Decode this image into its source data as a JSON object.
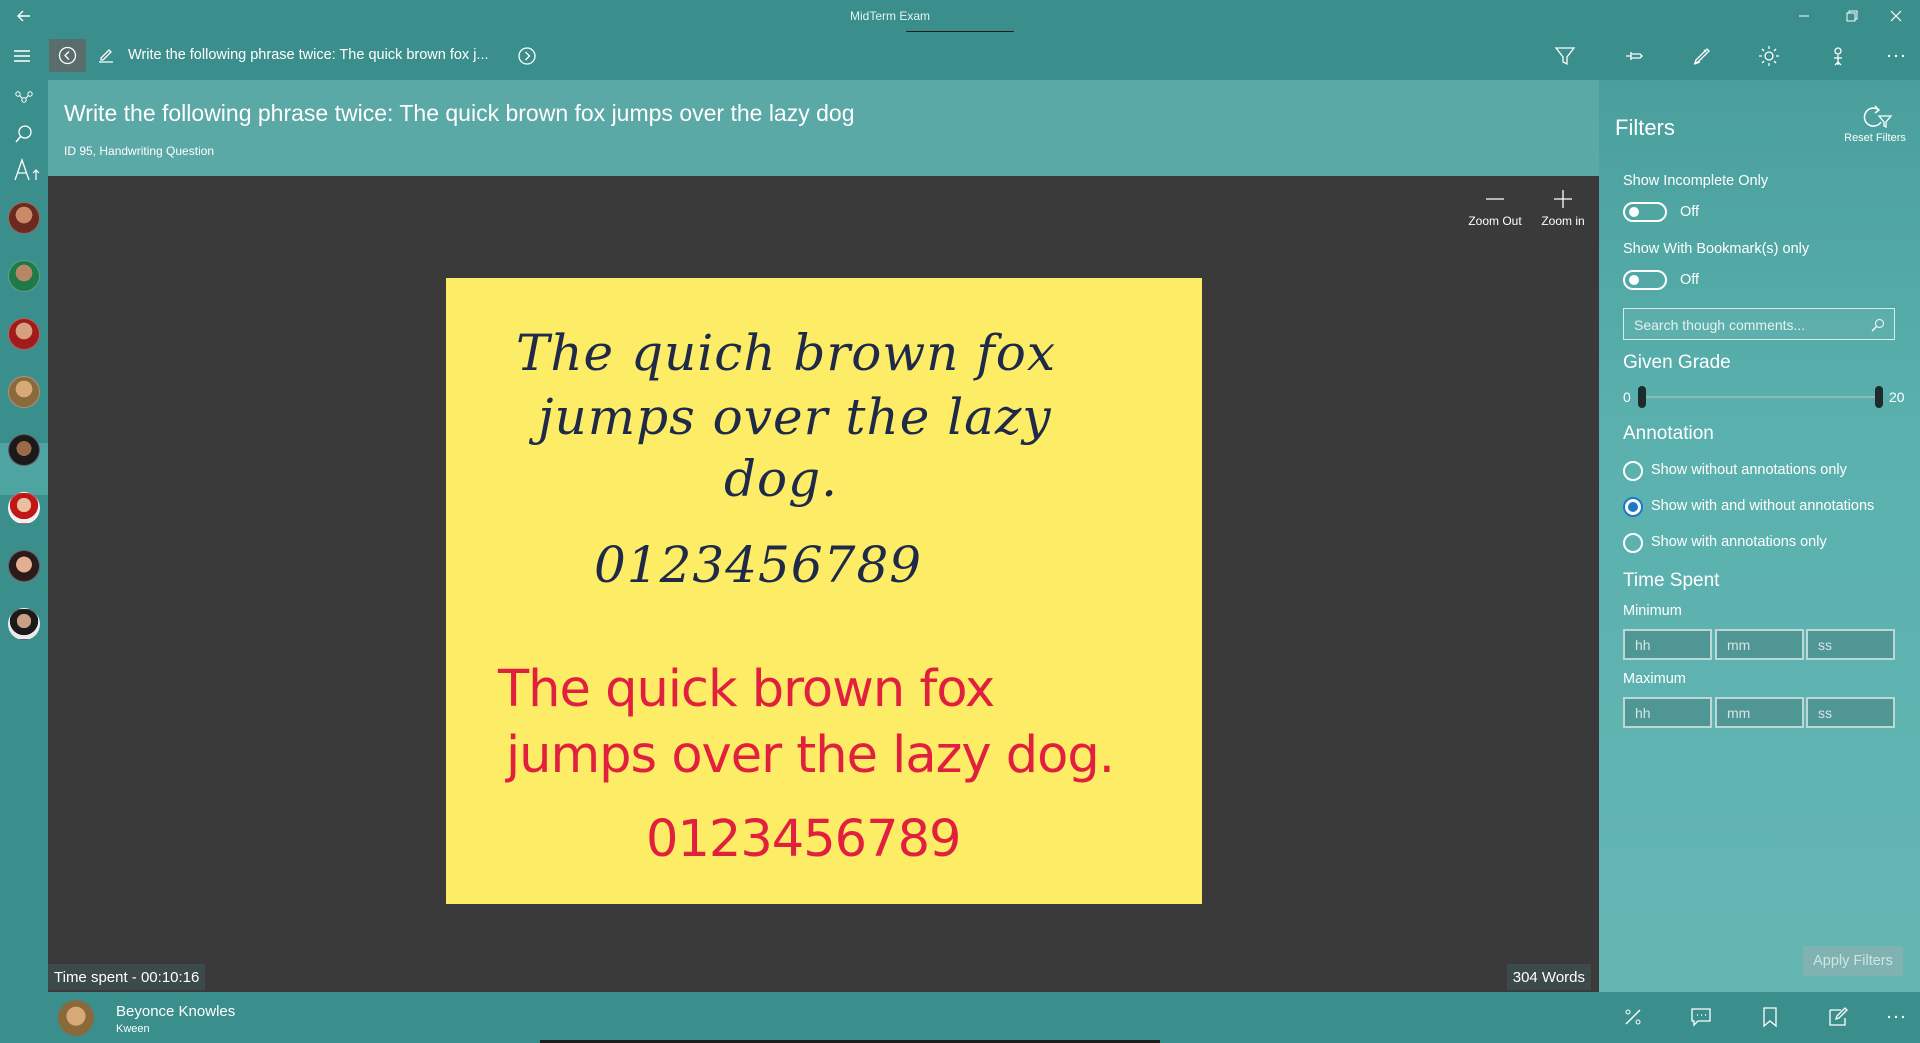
{
  "window": {
    "title": "MidTerm Exam"
  },
  "toolbar": {
    "question_title": "Write the following phrase twice: The quick brown fox j...",
    "icons": [
      "filter-icon",
      "pin-icon",
      "pen-icon",
      "brightness-icon",
      "user-rank-icon",
      "more-icon"
    ]
  },
  "rail": {
    "icons": [
      "group-icon",
      "search-icon",
      "sort-font-icon"
    ],
    "selected_index": 3
  },
  "question": {
    "title": "Write the following phrase twice: The quick brown fox jumps over the lazy dog",
    "meta": "ID 95, Handwriting Question"
  },
  "viewer": {
    "zoom_out_label": "Zoom Out",
    "zoom_in_label": "Zoom in",
    "note": {
      "blue_lines": [
        "The quich brown fox",
        "jumps over the lazy",
        "dog.",
        "0123456789"
      ],
      "red_lines": [
        "The quick brown fox",
        "jumps over the lazy dog.",
        "0123456789"
      ]
    },
    "time_spent": "Time spent - 00:10:16",
    "word_count": "304 Words"
  },
  "filters": {
    "title": "Filters",
    "reset_label": "Reset Filters",
    "incomplete_label": "Show Incomplete Only",
    "incomplete_state": "Off",
    "bookmark_label": "Show With Bookmark(s) only",
    "bookmark_state": "Off",
    "search_placeholder": "Search though comments...",
    "grade_heading": "Given Grade",
    "grade_min": "0",
    "grade_max": "20",
    "annotation_heading": "Annotation",
    "annotation_options": [
      {
        "label": "Show without annotations only",
        "selected": false
      },
      {
        "label": "Show with and without annotations",
        "selected": true
      },
      {
        "label": "Show with annotations only",
        "selected": false
      }
    ],
    "time_heading": "Time Spent",
    "minimum_label": "Minimum",
    "maximum_label": "Maximum",
    "time_placeholders": {
      "hh": "hh",
      "mm": "mm",
      "ss": "ss"
    },
    "apply_label": "Apply Filters"
  },
  "student": {
    "name": "Beyonce Knowles",
    "subtitle": "Kween"
  },
  "bottom_icons": [
    "percent-icon",
    "comment-icon",
    "bookmark-icon",
    "edit-note-icon",
    "more-icon"
  ]
}
